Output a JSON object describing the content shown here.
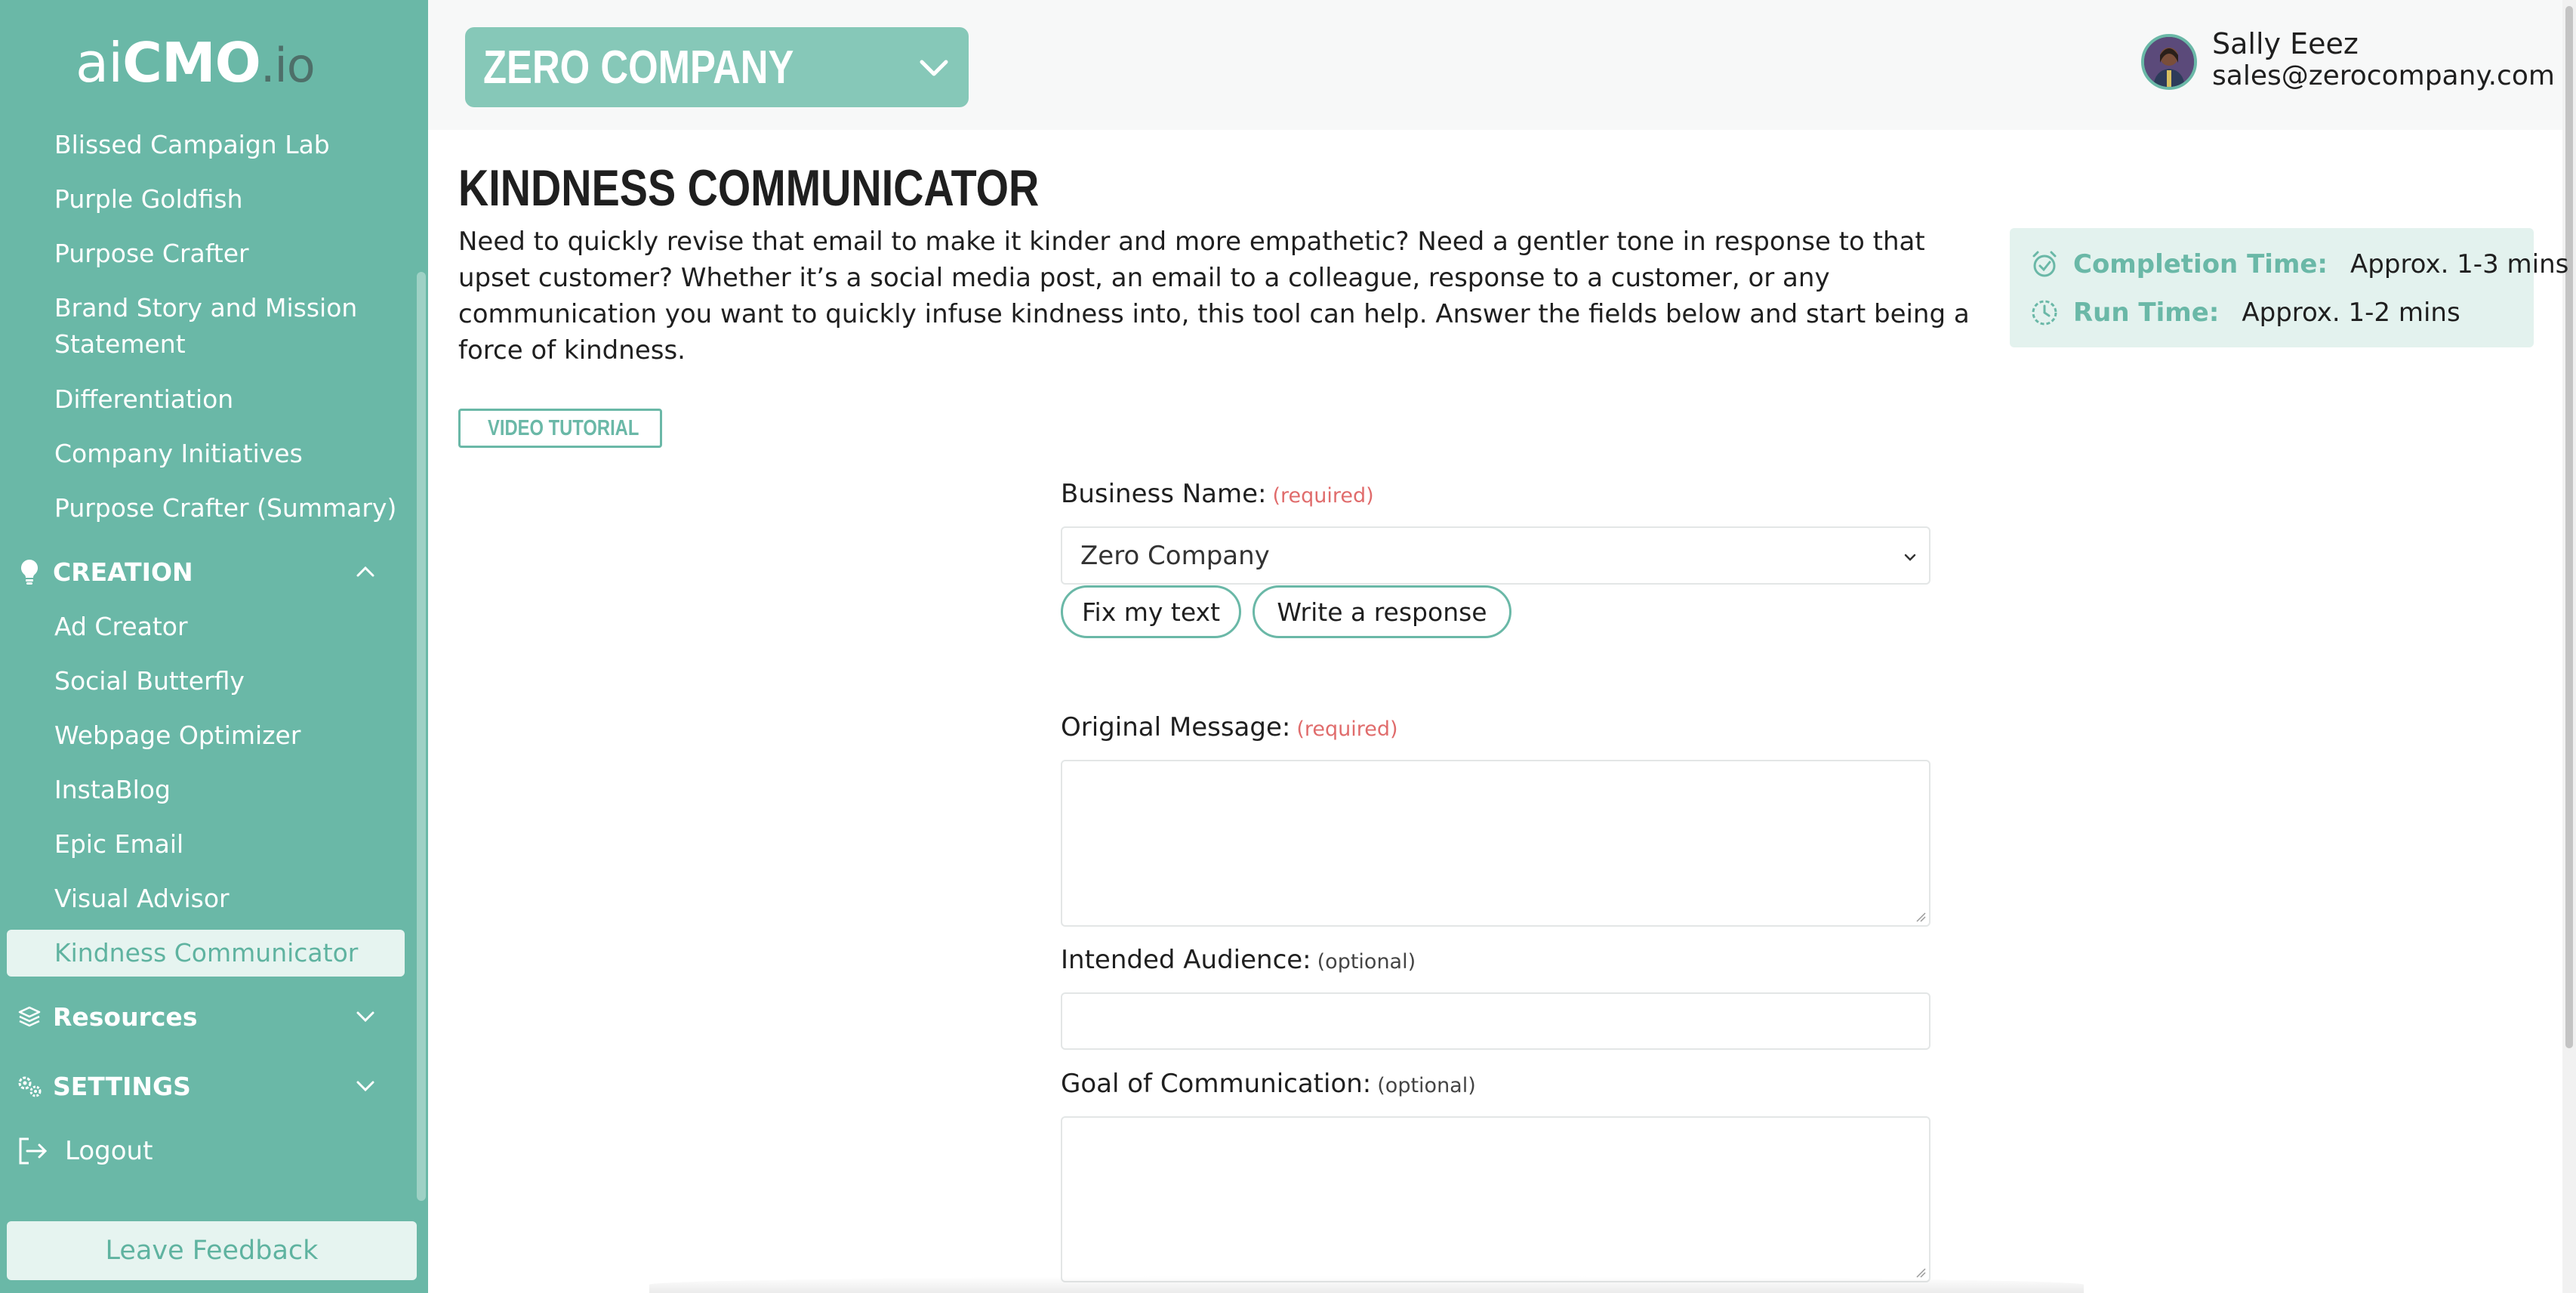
{
  "sidebar": {
    "logo": {
      "ai": "ai",
      "cmo": "CMO",
      "io": ".io"
    },
    "items_top": [
      {
        "label": "Blissed Campaign Lab"
      },
      {
        "label": "Purple Goldfish"
      },
      {
        "label": "Purpose Crafter"
      },
      {
        "label": "Brand Story and Mission Statement"
      },
      {
        "label": "Differentiation"
      },
      {
        "label": "Company Initiatives"
      },
      {
        "label": "Purpose Crafter (Summary)"
      }
    ],
    "creation": {
      "label": "CREATION",
      "icon": "lightbulb-icon",
      "items": [
        {
          "label": "Ad Creator"
        },
        {
          "label": "Social Butterfly"
        },
        {
          "label": "Webpage Optimizer"
        },
        {
          "label": "InstaBlog"
        },
        {
          "label": "Epic Email"
        },
        {
          "label": "Visual Advisor"
        },
        {
          "label": "Kindness Communicator",
          "active": true
        }
      ]
    },
    "resources": {
      "label": "Resources",
      "icon": "layers-icon"
    },
    "settings": {
      "label": "SETTINGS",
      "icon": "gears-icon"
    },
    "logout": {
      "label": "Logout",
      "icon": "logout-icon"
    },
    "feedback": {
      "label": "Leave Feedback"
    }
  },
  "header": {
    "company": "ZERO COMPANY",
    "user": {
      "name": "Sally Eeez",
      "email": "sales@zerocompany.com"
    }
  },
  "page": {
    "title": "KINDNESS COMMUNICATOR",
    "description": "Need to quickly revise that email to make it kinder and more empathetic? Need a gentler tone in response to that upset customer? Whether it’s a social media post, an email to a colleague, response to a customer, or any communication you want to quickly infuse kindness into, this tool can help. Answer the fields below and start being a force of kindness.",
    "completion_time": {
      "label": "Completion Time:",
      "value": "Approx. 1-3 mins"
    },
    "run_time": {
      "label": "Run Time:",
      "value": "Approx. 1-2 mins"
    },
    "video_tutorial": "VIDEO TUTORIAL"
  },
  "form": {
    "business_name": {
      "label": "Business Name:",
      "tag": "(required)",
      "value": "Zero Company"
    },
    "modes": [
      "Fix my text",
      "Write a response"
    ],
    "original_message": {
      "label": "Original Message:",
      "tag": "(required)",
      "value": ""
    },
    "intended_audience": {
      "label": "Intended Audience:",
      "tag": "(optional)",
      "value": ""
    },
    "goal": {
      "label": "Goal of Communication:",
      "tag": "(optional)",
      "value": ""
    }
  },
  "colors": {
    "sidebar": "#6ab8a7",
    "accent": "#6ab8a7",
    "active_bg": "#e6f4f0",
    "company_select": "#86c8b8",
    "required": "#e06c6c"
  }
}
